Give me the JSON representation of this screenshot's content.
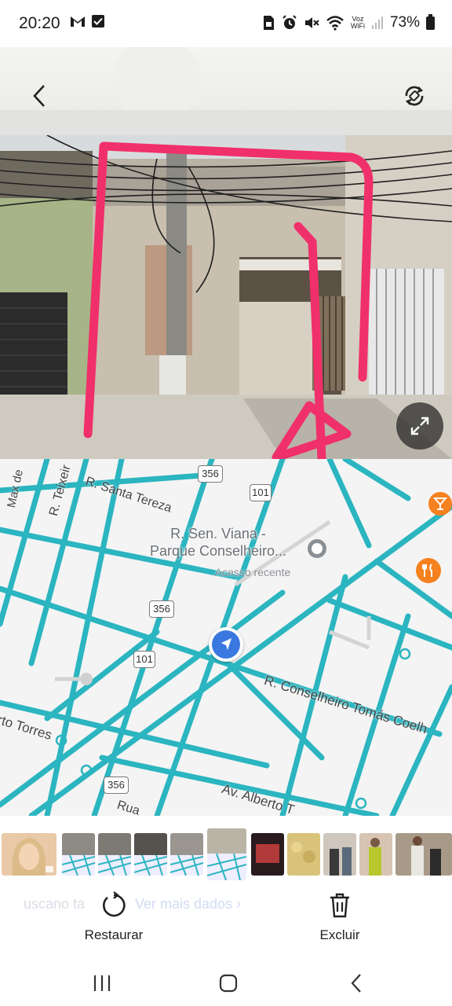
{
  "status_bar": {
    "time": "20:20",
    "left_icons": [
      "gmail-icon",
      "check-square-icon"
    ],
    "right_icons": [
      "sim-icon",
      "alarm-icon",
      "mute-icon",
      "wifi-icon",
      "signal-icon"
    ],
    "voz_line1": "Voz",
    "voz_line2": "WiFi",
    "battery": "73%"
  },
  "header": {
    "back_icon": "back-arrow-icon",
    "rotate_icon": "auto-rotate-icon"
  },
  "street_view": {
    "expand_icon": "expand-icon",
    "annotation_color": "#f0306a"
  },
  "map": {
    "road_color": "#2bb5c0",
    "place_title_line1": "R. Sen. Viana -",
    "place_title_line2": "Parque Conselheiro...",
    "place_subtitle": "Acesso recente",
    "streets": {
      "santa_tereza": "R. Santa Tereza",
      "teixeira": "R. Teixeir",
      "max": "Max de",
      "conselheiro": "R. Conselheiro Tomás Coelh",
      "alberto_torres_left": "rto Torres",
      "alberto_torres": "Av. Alberto T",
      "rua": "Rua"
    },
    "route_shields": [
      "356",
      "101",
      "356",
      "101",
      "356"
    ],
    "poi_icons": [
      "bar-icon",
      "restaurant-icon"
    ]
  },
  "thumbnails": [
    {
      "kind": "portrait",
      "label": "photo"
    },
    {
      "kind": "street-map",
      "label": "map"
    },
    {
      "kind": "street-map",
      "label": "map"
    },
    {
      "kind": "street-map",
      "label": "map"
    },
    {
      "kind": "street-map",
      "label": "map"
    },
    {
      "kind": "street-map-selected",
      "label": "map"
    },
    {
      "kind": "dark-poster",
      "label": "poster"
    },
    {
      "kind": "food",
      "label": "food"
    },
    {
      "kind": "people",
      "label": "people"
    },
    {
      "kind": "people",
      "label": "people"
    },
    {
      "kind": "people",
      "label": "people"
    }
  ],
  "ghost_text": {
    "left": "uscano ta",
    "right": "Ver mais dados  ›"
  },
  "actions": {
    "restore_label": "Restaurar",
    "delete_label": "Excluir"
  },
  "nav": {
    "recents_icon": "recent-apps-icon",
    "home_icon": "home-icon",
    "back_icon": "nav-back-icon"
  }
}
